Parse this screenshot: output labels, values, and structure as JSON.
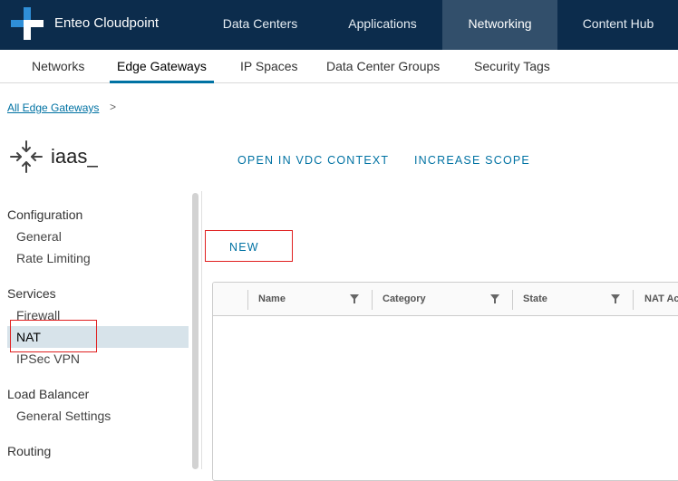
{
  "header": {
    "brand": "Enteo Cloudpoint",
    "nav": [
      {
        "label": "Data Centers"
      },
      {
        "label": "Applications"
      },
      {
        "label": "Networking",
        "active": true
      },
      {
        "label": "Content Hub"
      }
    ]
  },
  "subnav": {
    "tabs": [
      {
        "label": "Networks"
      },
      {
        "label": "Edge Gateways",
        "active": true
      },
      {
        "label": "IP Spaces"
      },
      {
        "label": "Data Center Groups"
      },
      {
        "label": "Security Tags"
      }
    ]
  },
  "breadcrumb": {
    "link": "All Edge Gateways",
    "separator": ">"
  },
  "gateway": {
    "name": "iaas_",
    "actions": {
      "open_vdc": "OPEN IN VDC CONTEXT",
      "increase_scope": "INCREASE SCOPE"
    }
  },
  "sidebar": {
    "sections": [
      {
        "title": "Configuration",
        "items": [
          "General",
          "Rate Limiting"
        ]
      },
      {
        "title": "Services",
        "items": [
          "Firewall",
          "NAT",
          "IPSec VPN"
        ]
      },
      {
        "title": "Load Balancer",
        "items": [
          "General Settings"
        ]
      },
      {
        "title": "Routing",
        "items": []
      }
    ],
    "selected": "NAT"
  },
  "main": {
    "new_button": "NEW",
    "grid": {
      "columns": [
        "Name",
        "Category",
        "State",
        "NAT Ac"
      ]
    }
  },
  "colors": {
    "header_bg": "#0c2c4c",
    "header_active": "#324f6b",
    "accent": "#0072a3",
    "highlight_box": "#e02020",
    "selected_bg": "#d7e3ea"
  }
}
